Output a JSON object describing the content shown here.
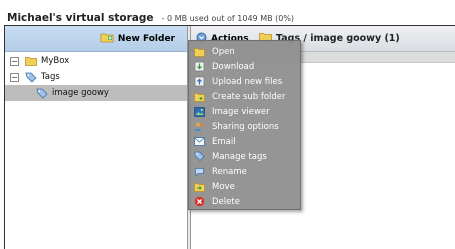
{
  "header": {
    "title": "Michael's virtual storage",
    "usage": "- 0 MB used out of 1049 MB (0%)"
  },
  "toolbar": {
    "new_folder_label": "New Folder",
    "actions_label": "Actions",
    "breadcrumb": "Tags / image goowy (1)"
  },
  "tree": {
    "items": [
      {
        "label": "MyBox",
        "toggle": "−"
      },
      {
        "label": "Tags",
        "toggle": "−"
      },
      {
        "label": "image goowy"
      }
    ]
  },
  "actions_menu": {
    "items": [
      {
        "label": "Open"
      },
      {
        "label": "Download"
      },
      {
        "label": "Upload new files"
      },
      {
        "label": "Create sub folder"
      },
      {
        "label": "Image viewer"
      },
      {
        "label": "Sharing options"
      },
      {
        "label": "Email"
      },
      {
        "label": "Manage tags"
      },
      {
        "label": "Rename"
      },
      {
        "label": "Move"
      },
      {
        "label": "Delete"
      }
    ]
  },
  "icons": {
    "new_folder": "new-folder-icon",
    "actions": "actions-icon",
    "breadcrumb": "folder-icon",
    "mybox": "folder-icon",
    "tags": "tag-icon",
    "tag_item": "tag-icon"
  }
}
